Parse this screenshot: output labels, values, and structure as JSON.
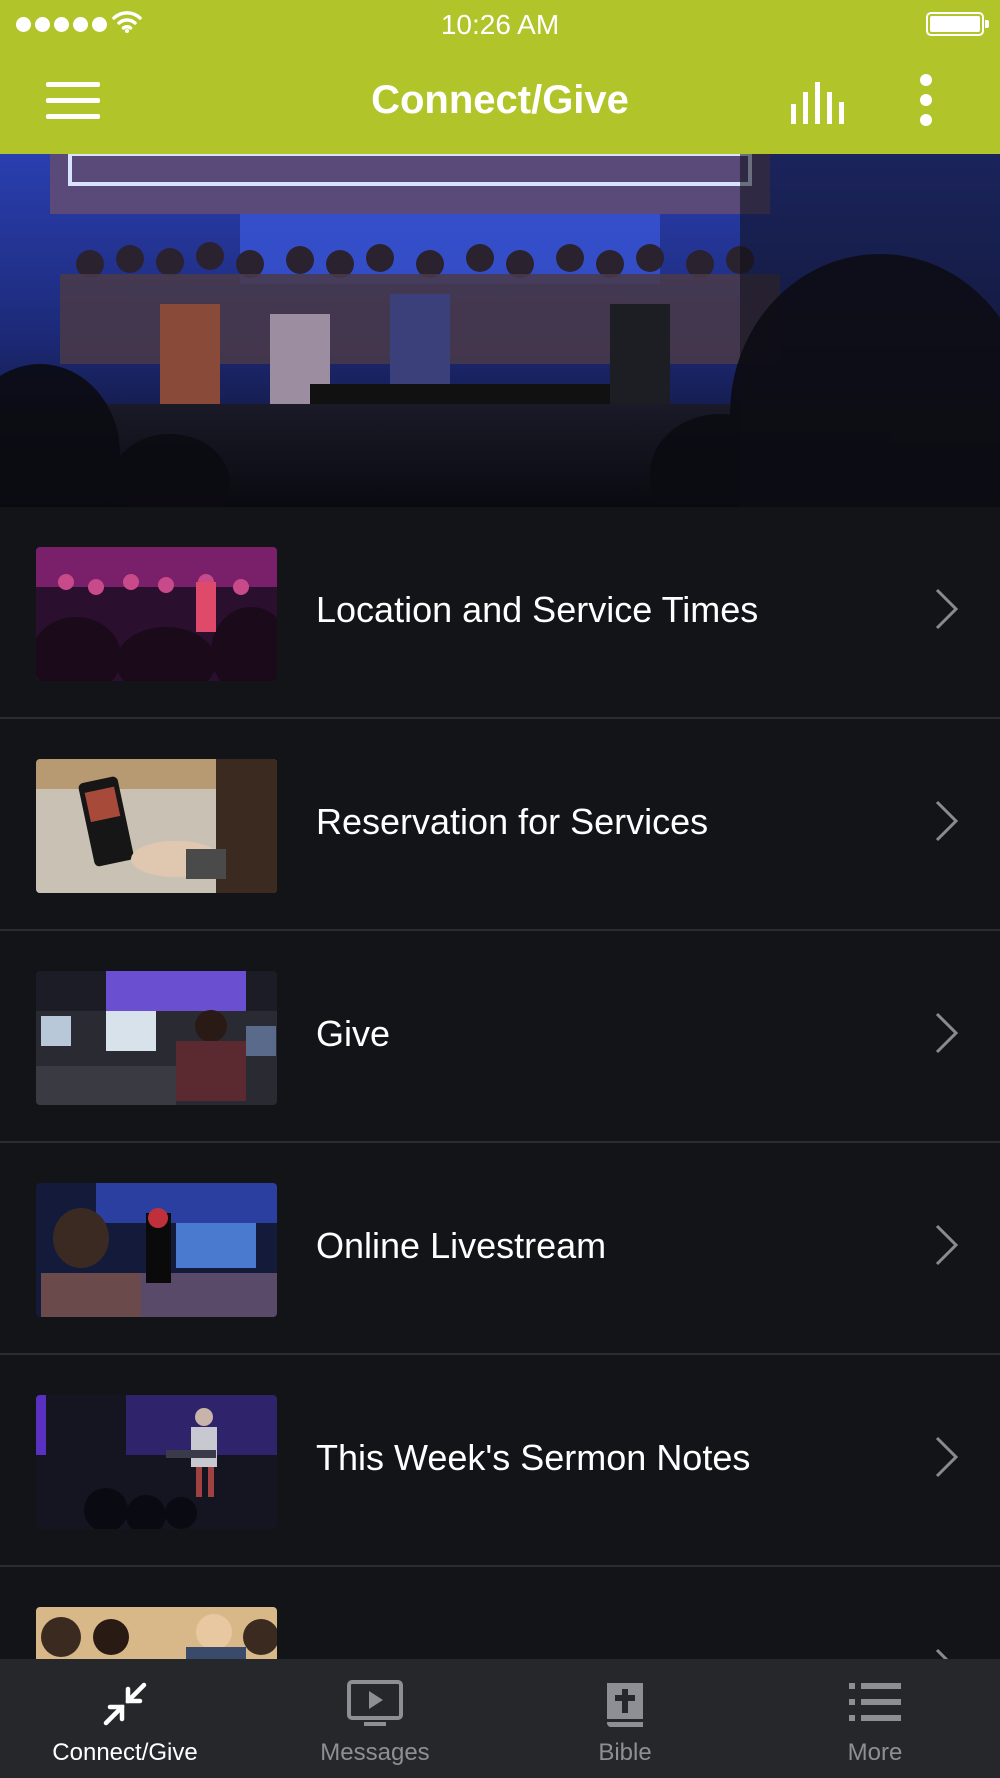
{
  "status_bar": {
    "time": "10:26 AM"
  },
  "app_bar": {
    "title": "Connect/Give"
  },
  "list": {
    "items": [
      {
        "label": "Location and Service Times"
      },
      {
        "label": "Reservation for Services"
      },
      {
        "label": "Give"
      },
      {
        "label": "Online Livestream"
      },
      {
        "label": "This Week's Sermon Notes"
      },
      {
        "label": ""
      }
    ]
  },
  "tab_bar": {
    "tabs": [
      {
        "label": "Connect/Give",
        "icon": "arrows-in-icon",
        "active": true
      },
      {
        "label": "Messages",
        "icon": "play-screen-icon",
        "active": false
      },
      {
        "label": "Bible",
        "icon": "bible-icon",
        "active": false
      },
      {
        "label": "More",
        "icon": "list-icon",
        "active": false
      }
    ]
  },
  "colors": {
    "accent": "#b1c42a",
    "background": "#131417",
    "tab_bar": "#26272b"
  }
}
